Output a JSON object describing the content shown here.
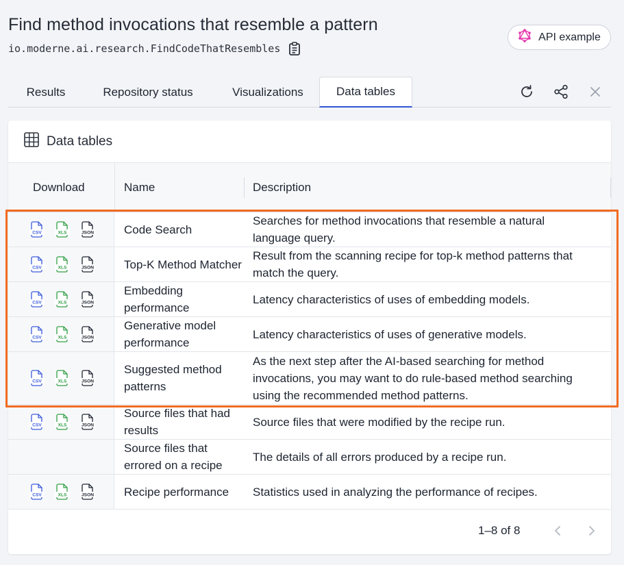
{
  "header": {
    "title": "Find method invocations that resemble a pattern",
    "recipe_id": "io.moderne.ai.research.FindCodeThatResembles",
    "api_button": "API example"
  },
  "tabs": [
    {
      "label": "Results"
    },
    {
      "label": "Repository status"
    },
    {
      "label": "Visualizations"
    },
    {
      "label": "Data tables",
      "active": true
    }
  ],
  "tab_icons": [
    "refresh-icon",
    "share-icon",
    "close-icon"
  ],
  "card": {
    "title": "Data tables",
    "columns": {
      "download": "Download",
      "name": "Name",
      "description": "Description"
    }
  },
  "file_labels": {
    "csv": "CSV",
    "xls": "XLS",
    "json": "JSON"
  },
  "rows": [
    {
      "name": "Code Search",
      "description": "Searches for method invocations that resemble a natural language query."
    },
    {
      "name": "Top-K Method Matcher",
      "description": "Result from the scanning recipe for top-k method patterns that match the query."
    },
    {
      "name": "Embedding performance",
      "description": "Latency characteristics of uses of embedding models."
    },
    {
      "name": "Generative model performance",
      "description": "Latency characteristics of uses of generative models."
    },
    {
      "name": "Suggested method patterns",
      "description": "As the next step after the AI-based searching for method invocations, you may want to do rule-based method searching using the recommended method patterns."
    },
    {
      "name": "Source files that had results",
      "description": "Source files that were modified by the recipe run."
    },
    {
      "name": "Source files that errored on a recipe",
      "description": "The details of all errors produced by a recipe run."
    },
    {
      "name": "Recipe performance",
      "description": "Statistics used in analyzing the performance of recipes."
    }
  ],
  "pagination": {
    "range": "1–8 of 8"
  },
  "colors": {
    "accent": "#2f55d4",
    "highlight": "#f26b21",
    "csv": "#3b5bdb",
    "xls": "#2f9e44",
    "json": "#1d2430",
    "graphql": "#e535ab"
  }
}
